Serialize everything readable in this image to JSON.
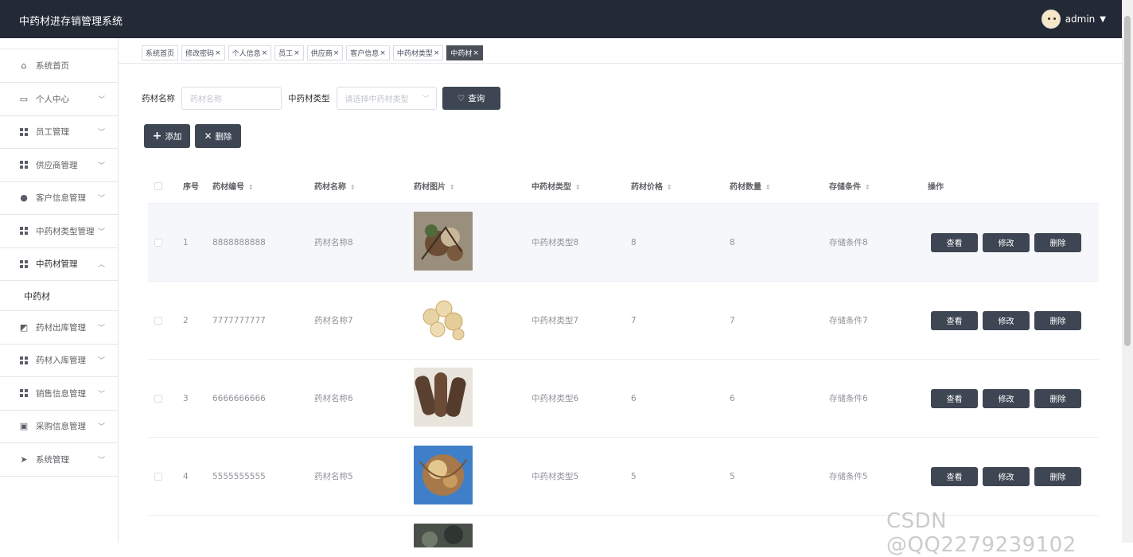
{
  "header": {
    "app_title": "中药材进存销管理系统",
    "user": "admin"
  },
  "sidebar": {
    "items": [
      {
        "label": "系统首页",
        "icon": "home-icon"
      },
      {
        "label": "个人中心",
        "icon": "card-icon"
      },
      {
        "label": "员工管理",
        "icon": "grid-icon"
      },
      {
        "label": "供应商管理",
        "icon": "grid-icon"
      },
      {
        "label": "客户信息管理",
        "icon": "user-icon"
      },
      {
        "label": "中药材类型管理",
        "icon": "grid-icon"
      },
      {
        "label": "中药材管理",
        "icon": "grid-icon"
      },
      {
        "label": "药材出库管理",
        "icon": "chart-icon"
      },
      {
        "label": "药材入库管理",
        "icon": "grid-icon"
      },
      {
        "label": "销售信息管理",
        "icon": "grid-icon"
      },
      {
        "label": "采购信息管理",
        "icon": "doc-icon"
      },
      {
        "label": "系统管理",
        "icon": "send-icon"
      }
    ],
    "sub_item": "中药材"
  },
  "tabs": [
    "系统首页",
    "修改密码",
    "个人信息",
    "员工",
    "供应商",
    "客户信息",
    "中药材类型",
    "中药材"
  ],
  "search": {
    "name_label": "药材名称",
    "name_placeholder": "药材名称",
    "type_label": "中药材类型",
    "type_placeholder": "请选择中药材类型",
    "query_button": "查询"
  },
  "actions": {
    "add": "添加",
    "delete": "删除"
  },
  "table": {
    "columns": [
      "序号",
      "药材编号",
      "药材名称",
      "药材图片",
      "中药材类型",
      "药材价格",
      "药材数量",
      "存储条件",
      "操作"
    ],
    "rows": [
      {
        "idx": "1",
        "code": "8888888888",
        "name": "药材名称8",
        "type": "中药材类型8",
        "price": "8",
        "qty": "8",
        "storage": "存储条件8"
      },
      {
        "idx": "2",
        "code": "7777777777",
        "name": "药材名称7",
        "type": "中药材类型7",
        "price": "7",
        "qty": "7",
        "storage": "存储条件7"
      },
      {
        "idx": "3",
        "code": "6666666666",
        "name": "药材名称6",
        "type": "中药材类型6",
        "price": "6",
        "qty": "6",
        "storage": "存储条件6"
      },
      {
        "idx": "4",
        "code": "5555555555",
        "name": "药材名称5",
        "type": "中药材类型5",
        "price": "5",
        "qty": "5",
        "storage": "存储条件5"
      }
    ],
    "row_buttons": {
      "view": "查看",
      "edit": "修改",
      "delete": "删除"
    }
  },
  "watermark": "CSDN @QQ2279239102"
}
